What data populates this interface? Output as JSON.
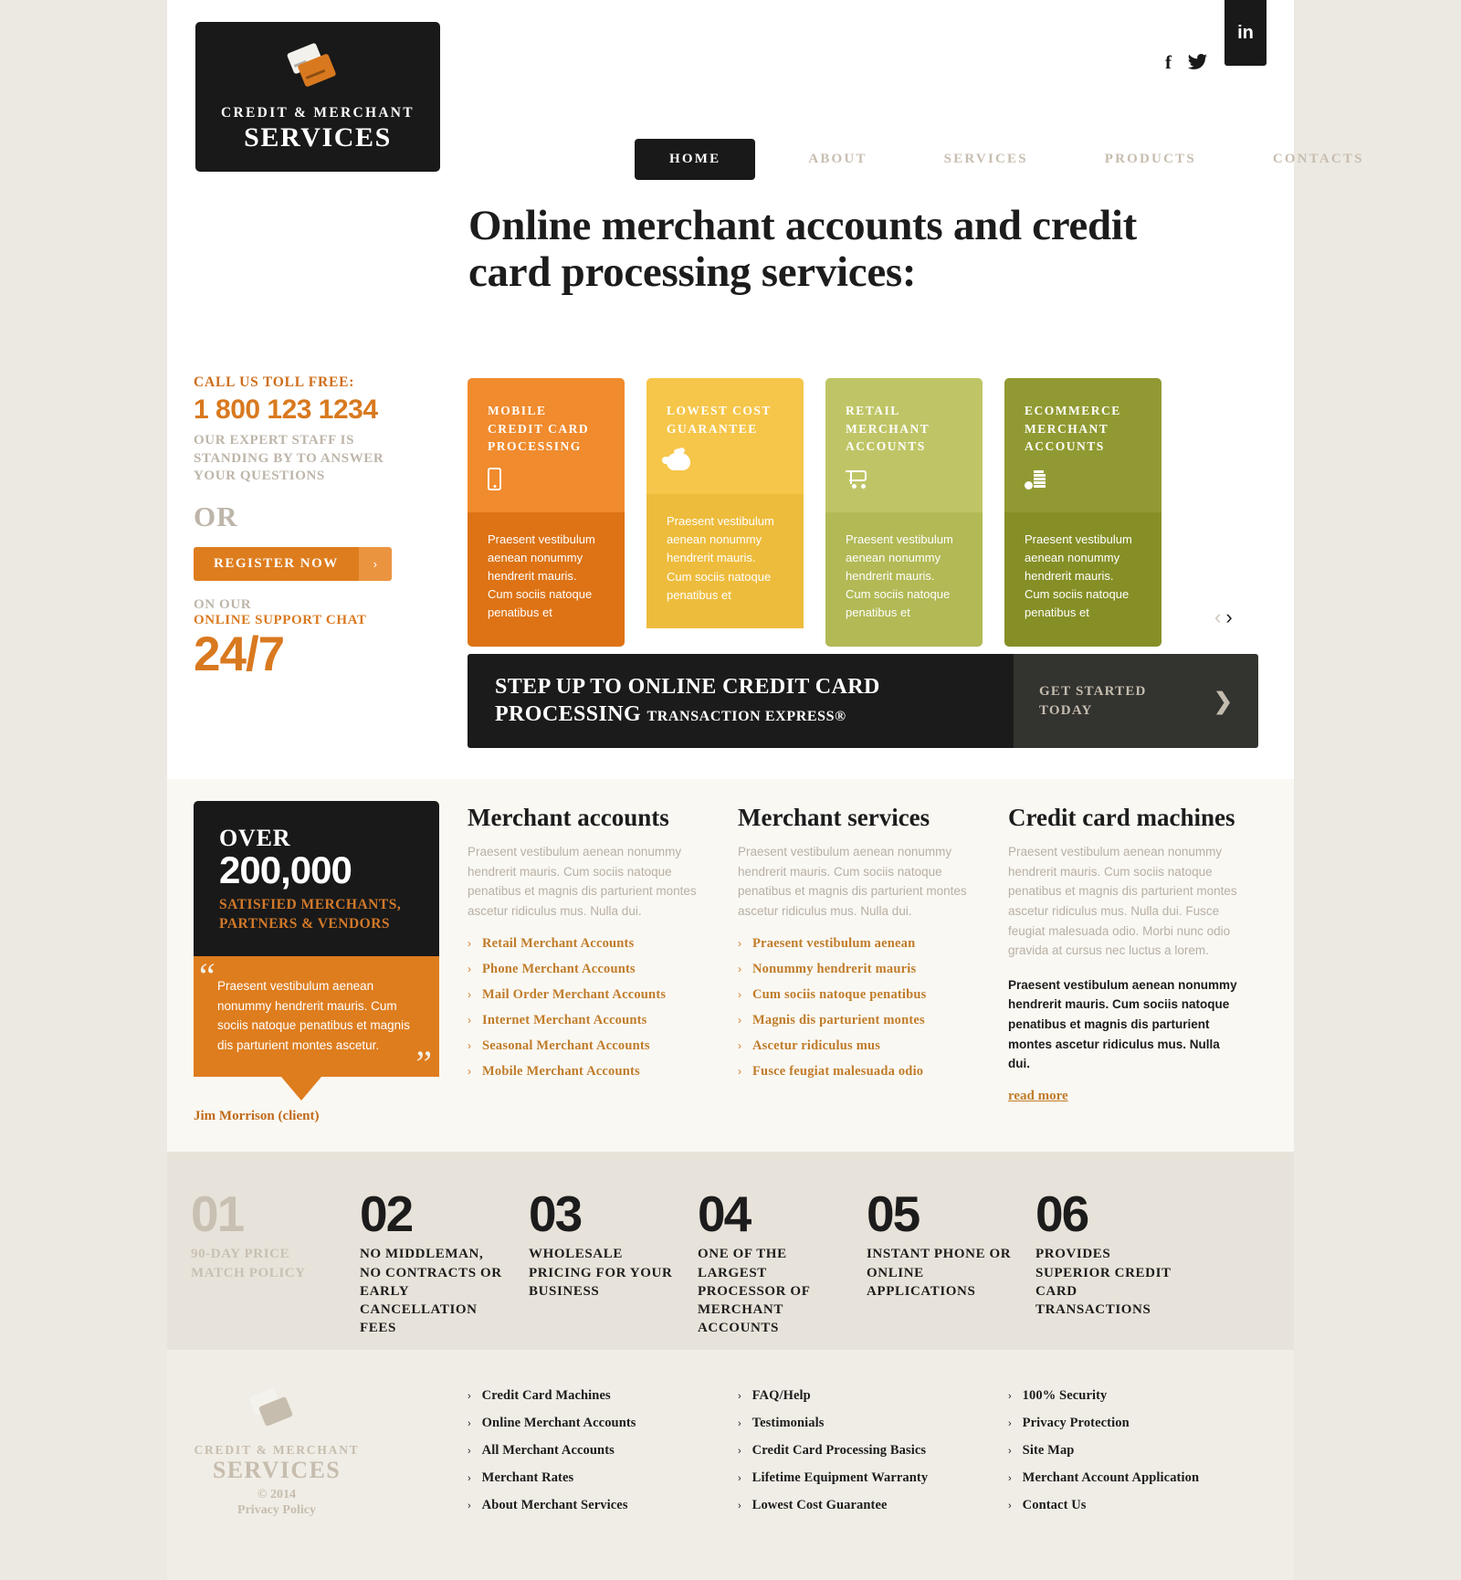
{
  "brand": {
    "logo_title": "CREDIT & MERCHANT",
    "logo_sub": "SERVICES",
    "logo_icon": "credit-cards-icon"
  },
  "social": {
    "facebook": "f",
    "twitter": "twitter-bird-icon",
    "linkedin": "in"
  },
  "nav": {
    "items": [
      {
        "label": "HOME",
        "active": true
      },
      {
        "label": "ABOUT",
        "active": false
      },
      {
        "label": "SERVICES",
        "active": false
      },
      {
        "label": "PRODUCTS",
        "active": false
      },
      {
        "label": "CONTACTS",
        "active": false
      }
    ]
  },
  "hero": {
    "title": "Online merchant accounts and credit card processing services:"
  },
  "cta": {
    "toll_free": "CALL US TOLL FREE:",
    "phone": "1 800 123 1234",
    "staff": "OUR EXPERT STAFF IS STANDING BY TO ANSWER YOUR QUESTIONS",
    "or": "OR",
    "register_label": "REGISTER NOW",
    "register_arrow": "›",
    "on_our": "ON OUR",
    "chat": "ONLINE SUPPORT CHAT",
    "hours": "24/7"
  },
  "cards": {
    "items": [
      {
        "title": "MOBILE CREDIT CARD PROCESSING",
        "icon": "mobile-phone-icon",
        "body": "Praesent vestibulum aenean nonummy hendrerit mauris. Cum sociis natoque penatibus et",
        "top_color": "#f08b2e",
        "bottom_color": "#dd7315"
      },
      {
        "title": "LOWEST COST GUARANTEE",
        "icon": "piggy-bank-icon",
        "body": "Praesent vestibulum aenean nonummy hendrerit mauris. Cum sociis natoque penatibus et",
        "top_color": "#f6c64a",
        "bottom_color": "#eebc3c"
      },
      {
        "title": "RETAIL MERCHANT ACCOUNTS",
        "icon": "shopping-cart-icon",
        "body": "Praesent vestibulum aenean nonummy hendrerit mauris. Cum sociis natoque penatibus et",
        "top_color": "#bfc566",
        "bottom_color": "#b2b955"
      },
      {
        "title": "ECOMMERCE MERCHANT ACCOUNTS",
        "icon": "coin-stack-icon",
        "body": "Praesent vestibulum aenean nonummy hendrerit mauris. Cum sociis natoque penatibus et",
        "top_color": "#919a32",
        "bottom_color": "#868f26"
      }
    ],
    "prev": "‹",
    "next": "›"
  },
  "banner": {
    "heading_line1": "STEP UP TO ONLINE CREDIT CARD",
    "heading_line2": "PROCESSING",
    "heading_small": "TRANSACTION EXPRESS®",
    "cta": "GET STARTED TODAY",
    "cta_arrow": "❯"
  },
  "testimonial": {
    "over": "OVER",
    "number": "200,000",
    "subtitle": "SATISFIED MERCHANTS, PARTNERS & VENDORS",
    "quote_open": "“",
    "quote_close": "”",
    "quote": "Praesent vestibulum aenean nonummy hendrerit mauris. Cum sociis natoque penatibus et magnis dis parturient montes ascetur.",
    "author": "Jim Morrison (client)"
  },
  "columns": [
    {
      "heading": "Merchant accounts",
      "paragraph": "Praesent vestibulum aenean nonummy hendrerit mauris. Cum sociis natoque penatibus et magnis dis parturient montes ascetur ridiculus mus. Nulla dui.",
      "links": [
        "Retail Merchant Accounts",
        "Phone Merchant Accounts",
        "Mail Order Merchant Accounts",
        "Internet Merchant Accounts",
        "Seasonal Merchant Accounts",
        "Mobile Merchant Accounts"
      ]
    },
    {
      "heading": "Merchant services",
      "paragraph": "Praesent vestibulum aenean nonummy hendrerit mauris. Cum sociis natoque penatibus et magnis dis parturient montes ascetur ridiculus mus. Nulla dui.",
      "links": [
        "Praesent vestibulum aenean",
        "Nonummy hendrerit mauris",
        "Cum sociis natoque penatibus",
        "Magnis dis parturient montes",
        "Ascetur ridiculus mus",
        "Fusce feugiat malesuada odio"
      ]
    },
    {
      "heading": "Credit card machines",
      "paragraph": "Praesent vestibulum aenean nonummy hendrerit mauris. Cum sociis natoque penatibus et magnis dis parturient montes ascetur ridiculus mus. Nulla dui. Fusce feugiat malesuada odio. Morbi nunc odio gravida at cursus nec luctus a lorem.",
      "paragraph_bold": "Praesent vestibulum aenean nonummy hendrerit mauris. Cum sociis natoque penatibus et magnis dis parturient montes ascetur ridiculus mus. Nulla dui.",
      "read_more": "read more"
    }
  ],
  "numbers": [
    {
      "n": "01",
      "text": "90-DAY PRICE MATCH POLICY",
      "muted": true
    },
    {
      "n": "02",
      "text": "NO MIDDLEMAN, NO CONTRACTS OR EARLY CANCELLATION FEES",
      "muted": false
    },
    {
      "n": "03",
      "text": "WHOLESALE PRICING FOR YOUR BUSINESS",
      "muted": false
    },
    {
      "n": "04",
      "text": "ONE OF THE LARGEST PROCESSOR OF MERCHANT ACCOUNTS",
      "muted": false
    },
    {
      "n": "05",
      "text": "INSTANT PHONE OR ONLINE APPLICATIONS",
      "muted": false
    },
    {
      "n": "06",
      "text": "PROVIDES SUPERIOR CREDIT CARD TRANSACTIONS",
      "muted": false
    }
  ],
  "footer": {
    "logo_title": "CREDIT & MERCHANT",
    "logo_sub": "SERVICES",
    "copyright": "© 2014",
    "privacy": "Privacy Policy",
    "columns": [
      {
        "links": [
          "Credit Card Machines",
          "Online Merchant Accounts",
          "All Merchant Accounts",
          "Merchant Rates",
          "About Merchant Services"
        ]
      },
      {
        "links": [
          "FAQ/Help",
          "Testimonials",
          "Credit Card Processing Basics",
          "Lifetime Equipment Warranty",
          "Lowest Cost Guarantee"
        ]
      },
      {
        "links": [
          "100% Security",
          "Privacy Protection",
          "Site Map",
          "Merchant Account Application",
          "Contact Us"
        ]
      }
    ]
  },
  "colors": {
    "accent_orange": "#de7d1e",
    "dark": "#191919",
    "page_bg": "#ece9e2",
    "mid_bg": "#faf8f3",
    "numbers_bg": "#e8e3da",
    "footer_bg": "#f0ede6"
  }
}
